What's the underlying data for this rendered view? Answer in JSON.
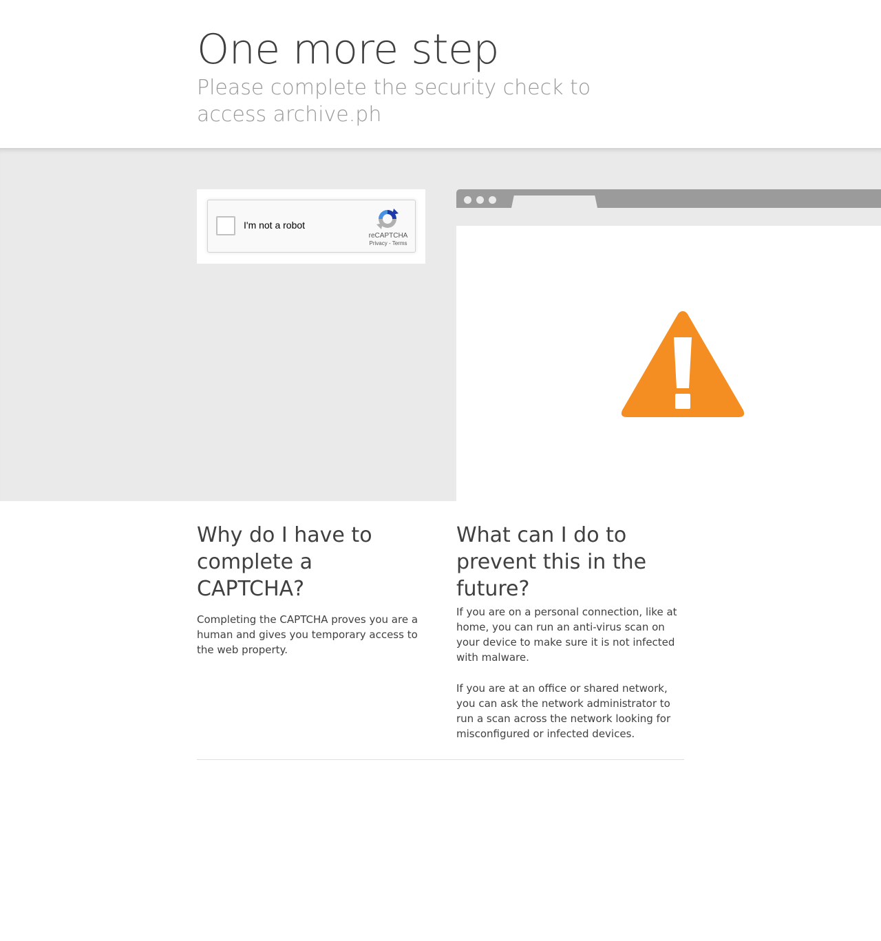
{
  "header": {
    "title": "One more step",
    "subtitle": "Please complete the security check to access archive.ph"
  },
  "captcha": {
    "checkbox_label": "I'm not a robot",
    "brand": "reCAPTCHA",
    "privacy_link": "Privacy",
    "link_separator": " - ",
    "terms_link": "Terms",
    "checked": false
  },
  "illustration": {
    "icon": "warning-icon",
    "color": "#f48e22"
  },
  "why": {
    "heading": "Why do I have to complete a CAPTCHA?",
    "body": "Completing the CAPTCHA proves you are a human and gives you temporary access to the web property."
  },
  "prevent": {
    "heading": "What can I do to prevent this in the future?",
    "paragraph1": "If you are on a personal connection, like at home, you can run an anti-virus scan on your device to make sure it is not infected with malware.",
    "paragraph2": "If you are at an office or shared network, you can ask the network administrator to run a scan across the network looking for misconfigured or infected devices."
  }
}
